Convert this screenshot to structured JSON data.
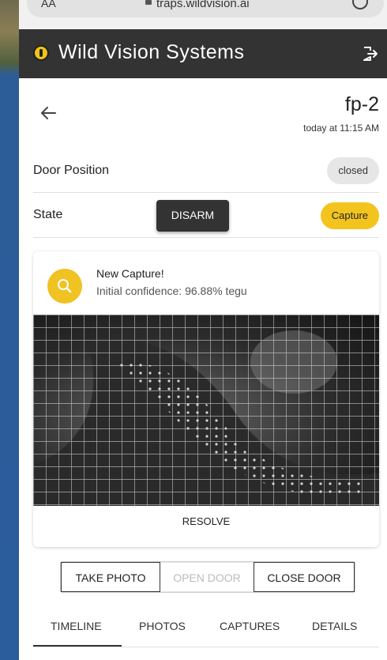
{
  "browser": {
    "aa_label": "AA",
    "url": "traps.wildvision.ai"
  },
  "app": {
    "title": "Wild Vision Systems",
    "accent_color": "#f0c419",
    "bar_color": "#333333",
    "logout_icon": "logout-icon"
  },
  "device": {
    "name": "fp-2",
    "last_seen": "today at 11:15 AM"
  },
  "door": {
    "label": "Door Position",
    "value": "closed"
  },
  "state": {
    "label": "State",
    "disarm_label": "DISARM",
    "value": "Capture"
  },
  "capture_card": {
    "title": "New Capture!",
    "subtitle": "Initial confidence: 96.88% tegu",
    "icon": "search-icon",
    "resolve_label": "RESOLVE"
  },
  "actions": {
    "take_photo": "TAKE PHOTO",
    "open_door": "OPEN DOOR",
    "close_door": "CLOSE DOOR"
  },
  "tabs": [
    {
      "label": "TIMELINE",
      "active": true
    },
    {
      "label": "PHOTOS",
      "active": false
    },
    {
      "label": "CAPTURES",
      "active": false
    },
    {
      "label": "DETAILS",
      "active": false
    }
  ]
}
